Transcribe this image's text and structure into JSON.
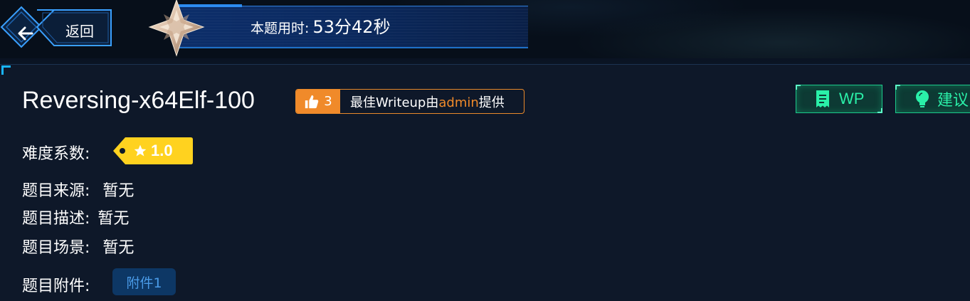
{
  "header": {
    "back_label": "返回",
    "timer_label": "本题用时:",
    "timer_value": "53分42秒"
  },
  "challenge": {
    "title": "Reversing-x64Elf-100",
    "likes": "3",
    "writeup_prefix": "最佳Writeup由",
    "writeup_author": "admin",
    "writeup_suffix": "提供"
  },
  "actions": {
    "wp_label": "WP",
    "suggest_label": "建议"
  },
  "details": {
    "difficulty_label": "难度系数:",
    "difficulty_value": "1.0",
    "source_label": "题目来源:",
    "source_value": "暂无",
    "description_label": "题目描述:",
    "description_value": "暂无",
    "scene_label": "题目场景:",
    "scene_value": "暂无",
    "attachment_label": "题目附件:",
    "attachment_value": "附件1"
  },
  "colors": {
    "accent_orange": "#f08a2a",
    "accent_green": "#2af0a8",
    "difficulty_yellow": "#ffd21f",
    "attachment_blue": "#4a9be8"
  },
  "icons": {
    "back": "arrow-left-icon",
    "rank": "compass-star-icon",
    "like": "thumbs-up-icon",
    "wp": "document-icon",
    "suggest": "lightbulb-icon",
    "difficulty": "star-icon"
  }
}
